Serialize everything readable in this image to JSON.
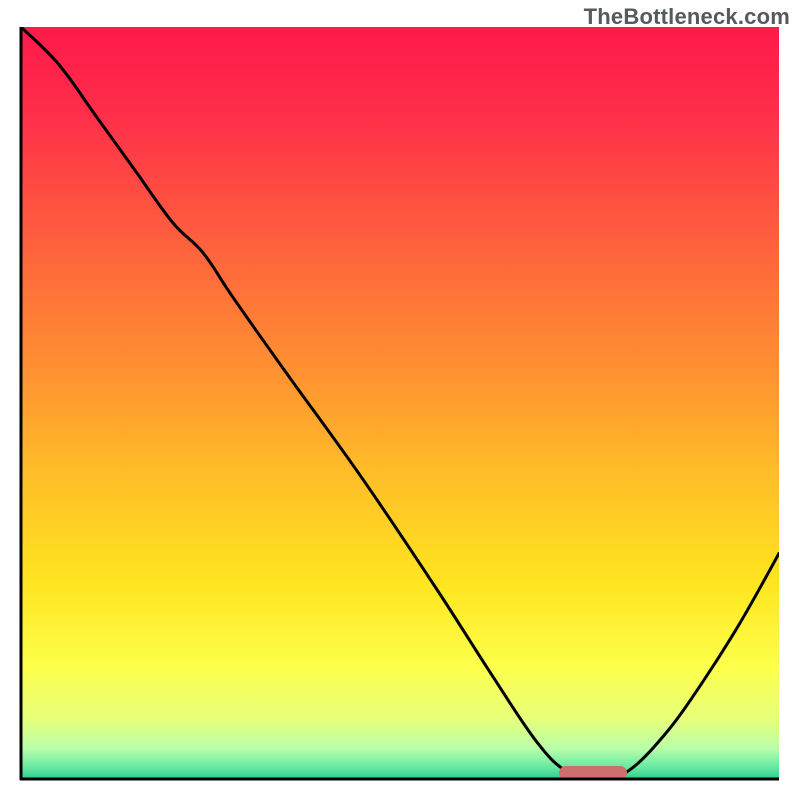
{
  "watermark": "TheBottleneck.com",
  "colors": {
    "gradient_stops": [
      {
        "offset": 0.0,
        "color": "#ff1a4a"
      },
      {
        "offset": 0.12,
        "color": "#ff2f49"
      },
      {
        "offset": 0.28,
        "color": "#ff5e3e"
      },
      {
        "offset": 0.45,
        "color": "#ff8f32"
      },
      {
        "offset": 0.6,
        "color": "#ffbf28"
      },
      {
        "offset": 0.74,
        "color": "#ffe51f"
      },
      {
        "offset": 0.85,
        "color": "#fdff4a"
      },
      {
        "offset": 0.92,
        "color": "#e7ff7a"
      },
      {
        "offset": 0.96,
        "color": "#b8ffaa"
      },
      {
        "offset": 0.985,
        "color": "#64e8a2"
      },
      {
        "offset": 1.0,
        "color": "#2ecf8a"
      }
    ],
    "curve": "#000000",
    "indicator": "#cf6e6e",
    "axis": "#000000"
  },
  "chart_data": {
    "type": "line",
    "title": "",
    "xlabel": "",
    "ylabel": "",
    "xlim": [
      0,
      100
    ],
    "ylim": [
      0,
      100
    ],
    "grid": false,
    "series": [
      {
        "name": "curve",
        "x": [
          0,
          5,
          10,
          15,
          20,
          24,
          28,
          35,
          45,
          55,
          62,
          68,
          72,
          76,
          80,
          85,
          90,
          95,
          100
        ],
        "y": [
          100,
          95,
          88,
          81,
          74,
          70,
          64,
          54,
          40,
          25,
          14,
          5,
          1,
          0,
          1,
          6,
          13,
          21,
          30
        ]
      }
    ],
    "annotations": [
      {
        "name": "optimal-range",
        "x_start": 71,
        "x_end": 80,
        "y": 0.8
      }
    ]
  }
}
